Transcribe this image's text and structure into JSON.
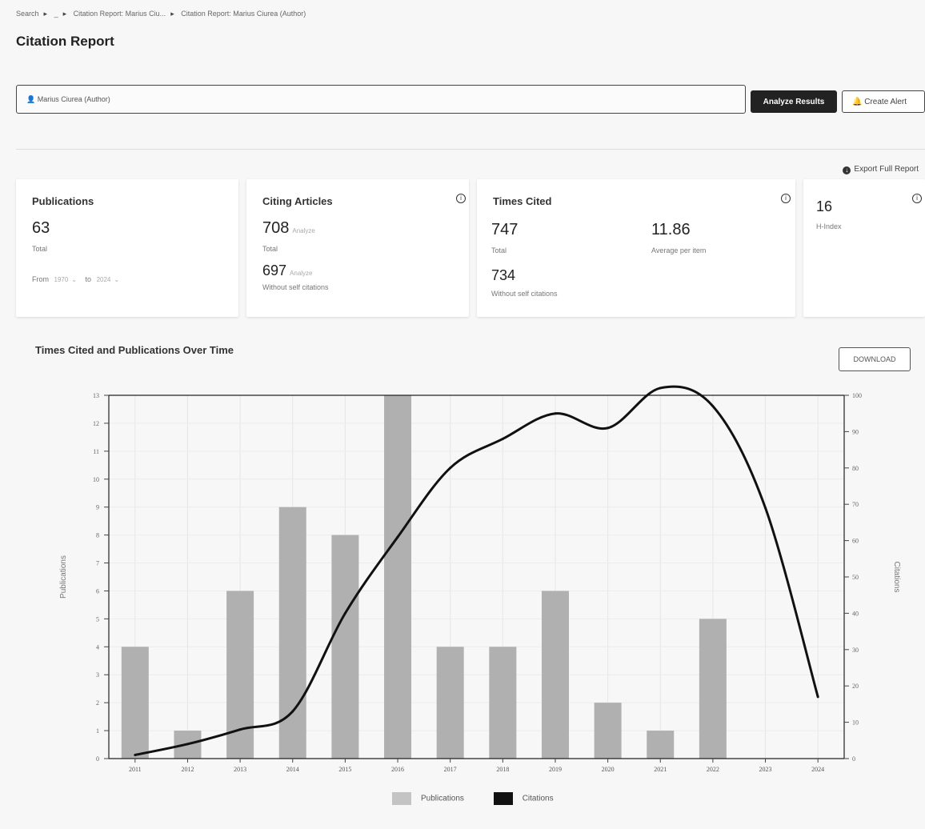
{
  "breadcrumb": {
    "items": [
      "Search",
      "_",
      "Citation Report: Marius Ciu...",
      "Citation Report: Marius Ciurea (Author)"
    ]
  },
  "page_title": "Citation Report",
  "search": {
    "query": "Marius Ciurea (Author)"
  },
  "buttons": {
    "analyze": "Analyze Results",
    "alert": "Create Alert",
    "export": "Export Full Report",
    "download": "DOWNLOAD"
  },
  "cards": {
    "publications": {
      "title": "Publications",
      "value": "63",
      "value_label": "Total",
      "from_label": "From",
      "from_value": "1970",
      "to_label": "to",
      "to_value": "2024"
    },
    "citing": {
      "title": "Citing Articles",
      "total": "708",
      "total_label": "Total",
      "without": "697",
      "without_label": "Without self citations",
      "analyze": "Analyze"
    },
    "cited": {
      "title": "Times Cited",
      "total": "747",
      "total_label": "Total",
      "avg": "11.86",
      "avg_label": "Average per item",
      "without": "734",
      "without_label": "Without self citations"
    },
    "hindex": {
      "value": "16",
      "label": "H-Index"
    }
  },
  "colors": {
    "bar": "#b0b0b0",
    "line": "#111111",
    "legend_bar": "#c4c4c4"
  },
  "chart_data": {
    "type": "bar",
    "title": "Times Cited and Publications Over Time",
    "categories": [
      "2011",
      "2012",
      "2013",
      "2014",
      "2015",
      "2016",
      "2017",
      "2018",
      "2019",
      "2020",
      "2021",
      "2022",
      "2023",
      "2024"
    ],
    "series": [
      {
        "name": "Publications",
        "type": "bar",
        "axis": "left",
        "values": [
          4,
          1,
          6,
          9,
          8,
          13,
          4,
          4,
          6,
          2,
          1,
          5,
          0,
          0
        ]
      },
      {
        "name": "Citations",
        "type": "line",
        "axis": "right",
        "values": [
          1,
          4,
          8,
          13,
          40,
          61,
          80,
          88,
          95,
          91,
          102,
          97,
          69,
          17
        ]
      }
    ],
    "y_left": {
      "label": "Publications",
      "range": [
        0,
        13
      ],
      "ticks": [
        0,
        1,
        2,
        3,
        4,
        5,
        6,
        7,
        8,
        9,
        10,
        11,
        12,
        13
      ]
    },
    "y_right": {
      "label": "Citations",
      "range": [
        0,
        100
      ],
      "ticks": [
        0,
        10,
        20,
        30,
        40,
        50,
        60,
        70,
        80,
        90,
        100
      ]
    },
    "grid": true,
    "legend_position": "bottom"
  }
}
